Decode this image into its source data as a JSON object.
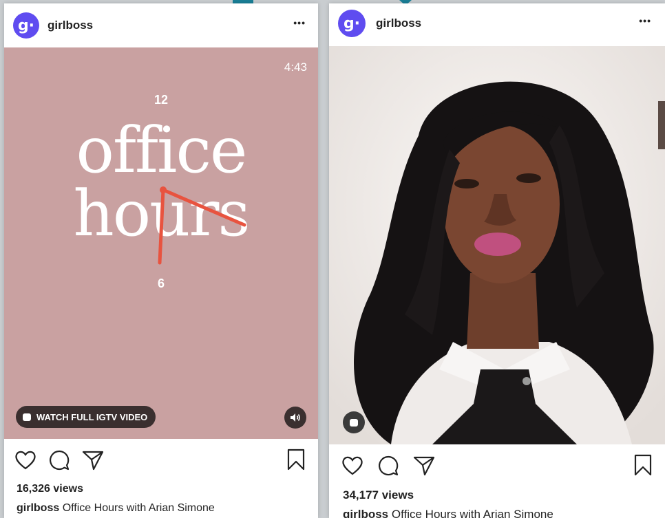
{
  "colors": {
    "brand_avatar": "#5f4cf0",
    "office_hours_bg": "#c9a1a1",
    "clock_hand": "#e8533f",
    "pill_bg": "#3a2f2f"
  },
  "post_left": {
    "username": "girlboss",
    "avatar_letter": "g·",
    "more_label": "•••",
    "duration": "4:43",
    "clock_top": "12",
    "clock_bottom": "6",
    "title_line1": "office",
    "title_line2": "hours",
    "igtv_label": "WATCH FULL IGTV VIDEO",
    "views": "16,326 views",
    "caption_user": "girlboss",
    "caption_text": "Office Hours with Arian Simone"
  },
  "post_right": {
    "username": "girlboss",
    "avatar_letter": "g·",
    "more_label": "•••",
    "views": "34,177 views",
    "caption_user": "girlboss",
    "caption_text": "Office Hours with Arian Simone"
  }
}
